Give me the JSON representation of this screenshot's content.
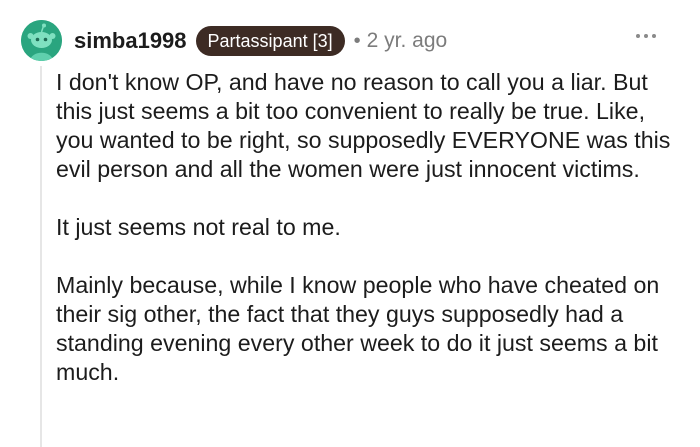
{
  "comment": {
    "username": "simba1998",
    "flair": "Partassipant [3]",
    "separator": "•",
    "timestamp": "2 yr. ago",
    "paragraphs": [
      "I don't know OP, and have no reason to call you a liar. But this just seems a bit too convenient to really be true. Like, you wanted to be right, so supposedly EVERYONE was this evil person and all the women were just innocent victims.",
      "It just seems not real to me.",
      "Mainly because, while I know people who have cheated on their sig other, the fact that they guys supposedly had a standing evening every other week to do it just seems a bit much."
    ]
  },
  "icons": {
    "avatar": "snoo-avatar-icon",
    "more": "more-options-icon"
  },
  "colors": {
    "avatar_bg": "#2aa57f",
    "flair_bg": "#3d2b24",
    "meta_text": "#7c7c7c"
  }
}
